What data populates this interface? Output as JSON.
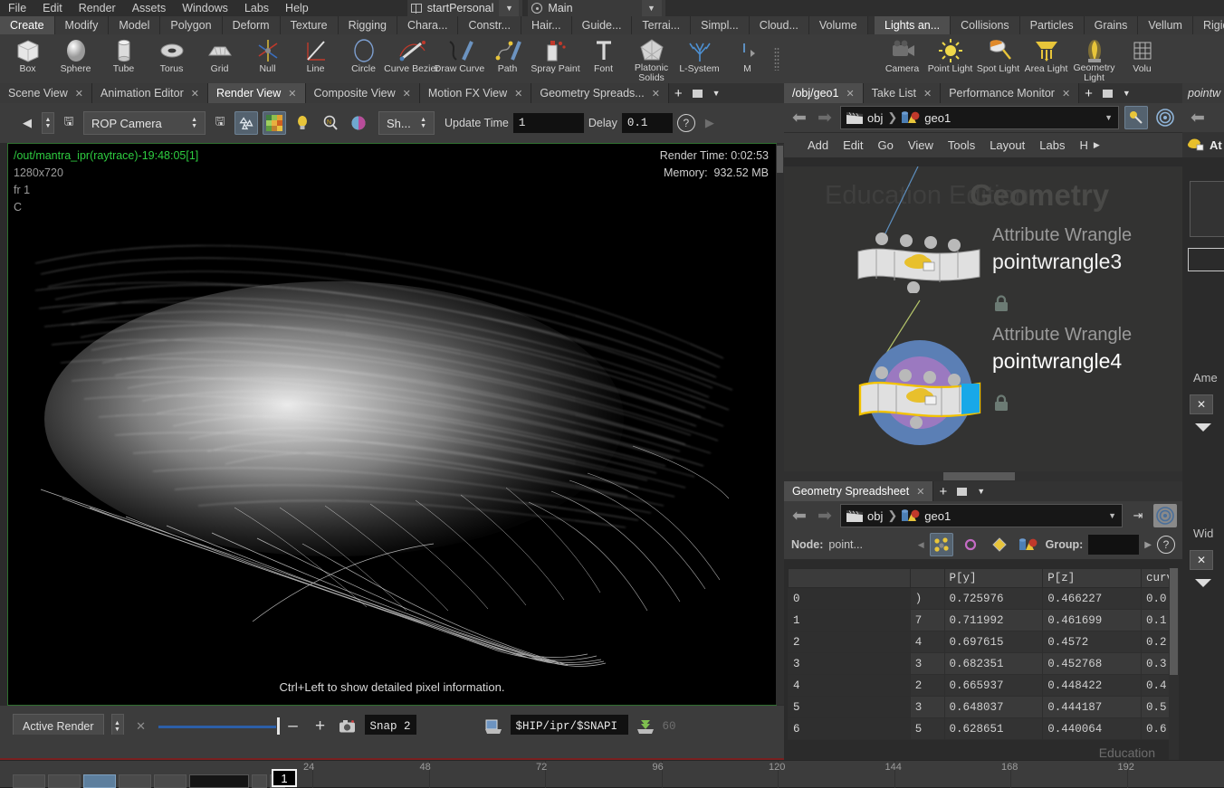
{
  "app": {
    "menu": [
      "File",
      "Edit",
      "Render",
      "Assets",
      "Windows",
      "Labs",
      "Help"
    ],
    "desktop_chip": "startPersonal",
    "layout_chip": "Main"
  },
  "shelf": {
    "tabs": [
      "Create",
      "Modify",
      "Model",
      "Polygon",
      "Deform",
      "Texture",
      "Rigging",
      "Chara...",
      "Constr...",
      "Hair...",
      "Guide...",
      "Terrai...",
      "Simpl...",
      "Cloud...",
      "Volume"
    ],
    "selected_tab": "Create",
    "plus_label": "+",
    "caret_label": "▼",
    "items": [
      {
        "name": "Box",
        "icon": "box-icon",
        "glyph": "▥"
      },
      {
        "name": "Sphere",
        "icon": "sphere-icon",
        "glyph": "⬤"
      },
      {
        "name": "Tube",
        "icon": "tube-icon",
        "glyph": "▮"
      },
      {
        "name": "Torus",
        "icon": "torus-icon",
        "glyph": "◎"
      },
      {
        "name": "Grid",
        "icon": "grid-icon",
        "glyph": "▱"
      },
      {
        "name": "Null",
        "icon": "null-icon",
        "glyph": "✳"
      },
      {
        "name": "Line",
        "icon": "line-icon",
        "glyph": "◸"
      },
      {
        "name": "Circle",
        "icon": "circle-icon",
        "glyph": "◯"
      },
      {
        "name": "Curve Bezier",
        "icon": "curve-bezier-icon",
        "glyph": "➶"
      },
      {
        "name": "Draw Curve",
        "icon": "draw-curve-icon",
        "glyph": "✎"
      },
      {
        "name": "Path",
        "icon": "path-icon",
        "glyph": "✐"
      },
      {
        "name": "Spray Paint",
        "icon": "spray-paint-icon",
        "glyph": "🖌"
      },
      {
        "name": "Font",
        "icon": "font-icon",
        "glyph": "T"
      },
      {
        "name": "Platonic Solids",
        "icon": "platonic-solids-icon",
        "glyph": "⬠"
      },
      {
        "name": "L-System",
        "icon": "l-system-icon",
        "glyph": "🜆"
      },
      {
        "name": "M",
        "icon": "more-icon",
        "glyph": "▌"
      }
    ],
    "tabs2": [
      "Lights an...",
      "Collisions",
      "Particles",
      "Grains",
      "Vellum",
      "Rigid Bo..."
    ],
    "selected_tab2": "Lights an...",
    "items2": [
      {
        "name": "Camera",
        "icon": "camera-icon",
        "glyph": "🎥"
      },
      {
        "name": "Point Light",
        "icon": "point-light-icon",
        "glyph": "☀"
      },
      {
        "name": "Spot Light",
        "icon": "spot-light-icon",
        "glyph": "🔦"
      },
      {
        "name": "Area Light",
        "icon": "area-light-icon",
        "glyph": "⛩"
      },
      {
        "name": "Geometry Light",
        "icon": "geometry-light-icon",
        "glyph": "🕴"
      },
      {
        "name": "Volu",
        "icon": "volume-light-icon",
        "glyph": "▦"
      }
    ]
  },
  "render_view": {
    "tabs": [
      "Scene View",
      "Animation Editor",
      "Render View",
      "Composite View",
      "Motion FX View",
      "Geometry Spreads..."
    ],
    "selected_tab": "Render View",
    "toolbar": {
      "camera_label": "ROP Camera",
      "shading_label": "Sh...",
      "update_time_label": "Update Time",
      "update_time_value": "1",
      "delay_label": "Delay",
      "delay_value": "0.1",
      "help_label": "?"
    },
    "header": {
      "path": "/out/mantra_ipr(raytrace)-19:48:05[1]",
      "resolution": "1280x720",
      "frame": "fr 1",
      "channel": "C",
      "render_time_label": "Render Time:",
      "render_time_value": "0:02:53",
      "memory_label": "Memory:",
      "memory_value": "932.52 MB"
    },
    "footer_hint": "Ctrl+Left to show detailed pixel information.",
    "bottombar": {
      "mode_label": "Active Render",
      "close_label": "✕",
      "minus_label": "–",
      "plus_label": "+",
      "snap_label": "Snap  2",
      "snapshot_path": "$HIP/ipr/$SNAPI",
      "quality_value": "60"
    }
  },
  "network": {
    "tabs": [
      "/obj/geo1",
      "Take List",
      "Performance Monitor"
    ],
    "selected_tab": "/obj/geo1",
    "path": [
      "obj",
      "geo1"
    ],
    "menu": [
      "Add",
      "Edit",
      "Go",
      "View",
      "Tools",
      "Layout",
      "Labs",
      "H"
    ],
    "watermark_edition": "Education Edition",
    "watermark_context": "Geometry",
    "nodes": [
      {
        "type": "Attribute Wrangle",
        "name": "pointwrangle3",
        "selected": false,
        "locked": true
      },
      {
        "type": "Attribute Wrangle",
        "name": "pointwrangle4",
        "selected": true,
        "locked": true
      }
    ]
  },
  "spreadsheet": {
    "tabs": [
      "Geometry Spreadsheet"
    ],
    "selected_tab": "Geometry Spreadsheet",
    "path": [
      "obj",
      "geo1"
    ],
    "node_label": "Node:",
    "node_value": "point...",
    "group_label": "Group:",
    "group_value": "",
    "help_label": "?",
    "watermark": "Education",
    "columns": [
      "",
      "",
      "P[y]",
      "P[z]",
      "curv"
    ],
    "rows": [
      {
        "index": "0",
        "px": ")",
        "py": "0.725976",
        "pz": "0.466227",
        "curv": "0.0"
      },
      {
        "index": "1",
        "px": "7",
        "py": "0.711992",
        "pz": "0.461699",
        "curv": "0.1"
      },
      {
        "index": "2",
        "px": "4",
        "py": "0.697615",
        "pz": "0.4572",
        "curv": "0.2"
      },
      {
        "index": "3",
        "px": "3",
        "py": "0.682351",
        "pz": "0.452768",
        "curv": "0.3"
      },
      {
        "index": "4",
        "px": "2",
        "py": "0.665937",
        "pz": "0.448422",
        "curv": "0.4"
      },
      {
        "index": "5",
        "px": "3",
        "py": "0.648037",
        "pz": "0.444187",
        "curv": "0.5"
      },
      {
        "index": "6",
        "px": "5",
        "py": "0.628651",
        "pz": "0.440064",
        "curv": "0.6"
      }
    ]
  },
  "parameters": {
    "tab_label": "pointw",
    "node_title": "At",
    "sections": [
      {
        "label": "Ame",
        "remove_label": "✕"
      },
      {
        "label": "Wid",
        "remove_label": "✕"
      }
    ]
  },
  "timeline": {
    "ticks": [
      "24",
      "48",
      "72",
      "96",
      "120",
      "144",
      "168",
      "192"
    ],
    "current_frame": "1"
  },
  "colors": {
    "accent_blue": "#2c5fa8",
    "render_green": "#2ecc40",
    "node_yellow": "#f2c200",
    "panel_bg": "#3c3c3c",
    "canvas_bg": "#333332"
  }
}
